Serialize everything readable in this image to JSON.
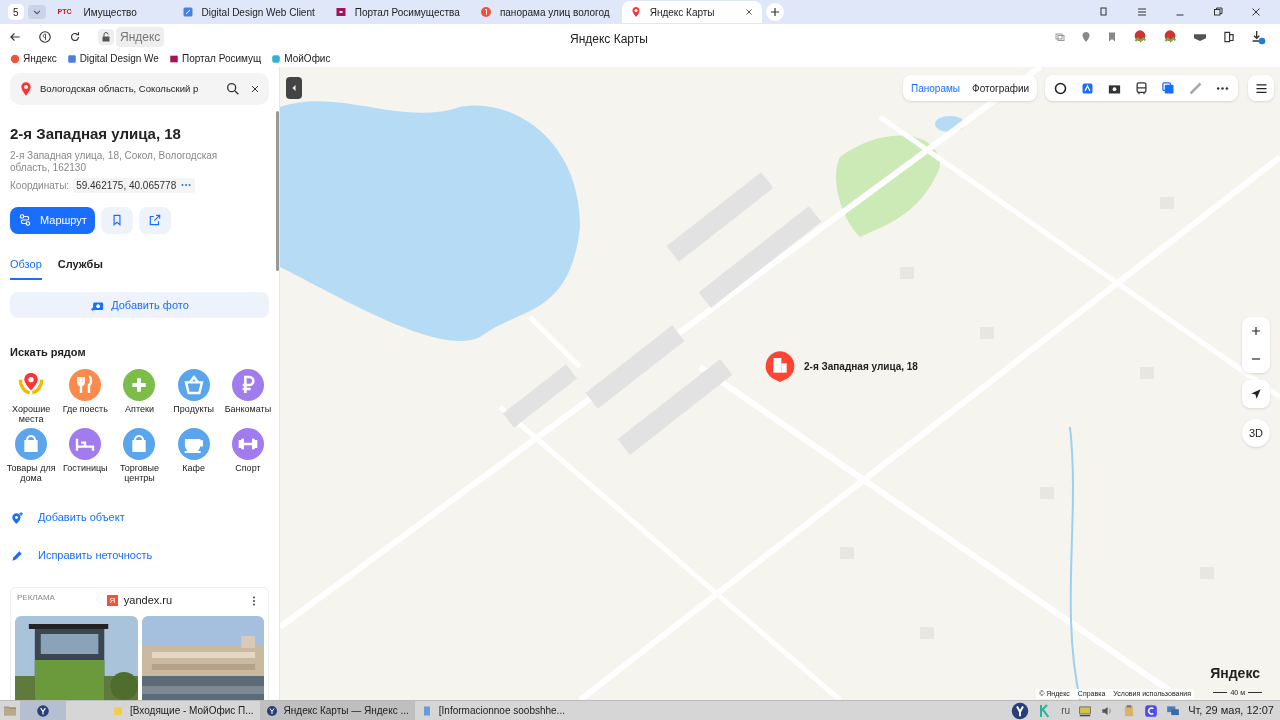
{
  "browser": {
    "tab_counter": "5",
    "tabs": [
      {
        "badge": "РТС",
        "label": "Имущество",
        "selected": false
      },
      {
        "label": "Digital Design Web Client",
        "selected": false
      },
      {
        "label": "Портал Росимущества",
        "selected": false
      },
      {
        "label": "панорама улиц вологод",
        "selected": false
      },
      {
        "label": "Яндекс Карты",
        "selected": true
      }
    ],
    "site": "Яндекс",
    "page_title": "Яндекс Карты",
    "bookmarks": [
      "Яндекс",
      "Digital Design We",
      "Портал Росимущ",
      "МойОфис"
    ]
  },
  "sidebar": {
    "search": {
      "value": "Вологодская область, Сокольский р"
    },
    "title": "2-я Западная улица, 18",
    "address": "2-я Западная улица, 18, Сокол, Вологодская область, 162130",
    "coords_label": "Координаты:",
    "coords": "59.462175, 40.065778",
    "route_button": "Маршрут",
    "tabs": [
      {
        "label": "Обзор",
        "selected": true
      },
      {
        "label": "Службы",
        "selected": false
      }
    ],
    "add_photo": "Добавить фото",
    "nearby_title": "Искать рядом",
    "categories": [
      {
        "kind": "laurel",
        "label": "Хорошие места"
      },
      {
        "kind": "circle",
        "label": "Где поесть",
        "color": "#fb8a4c"
      },
      {
        "kind": "circle",
        "label": "Аптеки",
        "color": "#7cbd4a"
      },
      {
        "kind": "circle",
        "label": "Продукты",
        "color": "#5aa5ee"
      },
      {
        "kind": "circle",
        "label": "Банкоматы",
        "color": "#a07cee"
      },
      {
        "kind": "circle",
        "label": "Товары для дома",
        "color": "#5aa5ee"
      },
      {
        "kind": "circle",
        "label": "Гостиницы",
        "color": "#a07cee"
      },
      {
        "kind": "circle",
        "label": "Торговые центры",
        "color": "#5aa5ee"
      },
      {
        "kind": "circle",
        "label": "Кафе",
        "color": "#5aa5ee"
      },
      {
        "kind": "circle",
        "label": "Спорт",
        "color": "#a07cee"
      }
    ],
    "actions": [
      "Добавить объект",
      "Исправить неточность"
    ],
    "ad": {
      "label": "РЕКЛАМА",
      "logo": "Я",
      "domain": "yandex.ru"
    }
  },
  "map": {
    "toolbar": [
      "Панорамы",
      "Фотографии"
    ],
    "marker_label": "2-я Западная улица, 18",
    "view_3d": "3D",
    "attribution": [
      "© Яндекс",
      "Справка",
      "Условия использования"
    ],
    "logo": "Яндекс",
    "scale": "40 м"
  },
  "taskbar": {
    "windows": [
      {
        "label": "[Входящие - МойОфис П...",
        "selected": false
      },
      {
        "label": "Яндекс Карты — Яндекс ...",
        "selected": true
      },
      {
        "label": "[Informacionnoe soobshhe...",
        "selected": false
      }
    ],
    "language": "ru",
    "clock": "Чт, 29 мая, 12:07"
  }
}
